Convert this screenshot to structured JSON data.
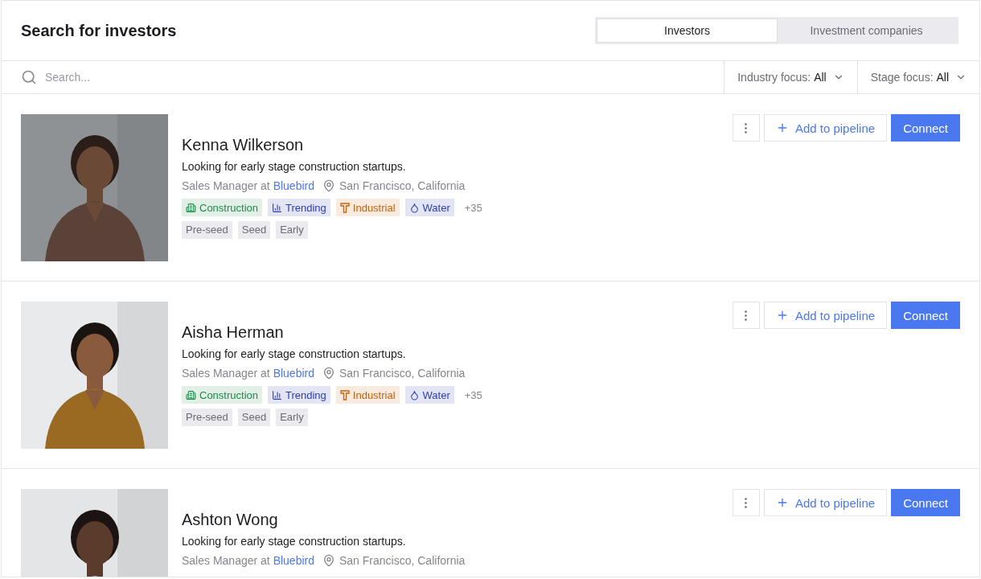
{
  "header": {
    "title": "Search for investors"
  },
  "tabs": [
    {
      "label": "Investors",
      "selected": true
    },
    {
      "label": "Investment companies",
      "selected": false
    }
  ],
  "search": {
    "placeholder": "Search..."
  },
  "filters": [
    {
      "label": "Industry focus:",
      "value": "All"
    },
    {
      "label": "Stage focus:",
      "value": "All"
    }
  ],
  "investors": [
    {
      "name": "Kenna Wilkerson",
      "bio": "Looking for early stage construction startups.",
      "role": "Sales Manager at",
      "company": "Bluebird",
      "location": "San Francisco, California",
      "tags": [
        {
          "label": "Construction",
          "kind": "building",
          "color": "#1f8a4c"
        },
        {
          "label": "Trending",
          "kind": "chart",
          "color": "#2a3fb0"
        },
        {
          "label": "Industrial",
          "kind": "beam",
          "color": "#c4620f"
        },
        {
          "label": "Water",
          "kind": "drop",
          "color": "#2a3fb0"
        }
      ],
      "more_tags": "+35",
      "stages": [
        "Pre-seed",
        "Seed",
        "Early"
      ],
      "add_button": "Add to pipeline",
      "connect_button": "Connect"
    },
    {
      "name": "Aisha Herman",
      "bio": "Looking for early stage construction startups.",
      "role": "Sales Manager at",
      "company": "Bluebird",
      "location": "San Francisco, California",
      "tags": [
        {
          "label": "Construction",
          "kind": "building",
          "color": "#1f8a4c"
        },
        {
          "label": "Trending",
          "kind": "chart",
          "color": "#2a3fb0"
        },
        {
          "label": "Industrial",
          "kind": "beam",
          "color": "#c4620f"
        },
        {
          "label": "Water",
          "kind": "drop",
          "color": "#2a3fb0"
        }
      ],
      "more_tags": "+35",
      "stages": [
        "Pre-seed",
        "Seed",
        "Early"
      ],
      "add_button": "Add to pipeline",
      "connect_button": "Connect"
    },
    {
      "name": "Ashton Wong",
      "bio": "Looking for early stage construction startups.",
      "role": "Sales Manager at",
      "company": "Bluebird",
      "location": "San Francisco, California",
      "add_button": "Add to pipeline",
      "connect_button": "Connect"
    }
  ]
}
